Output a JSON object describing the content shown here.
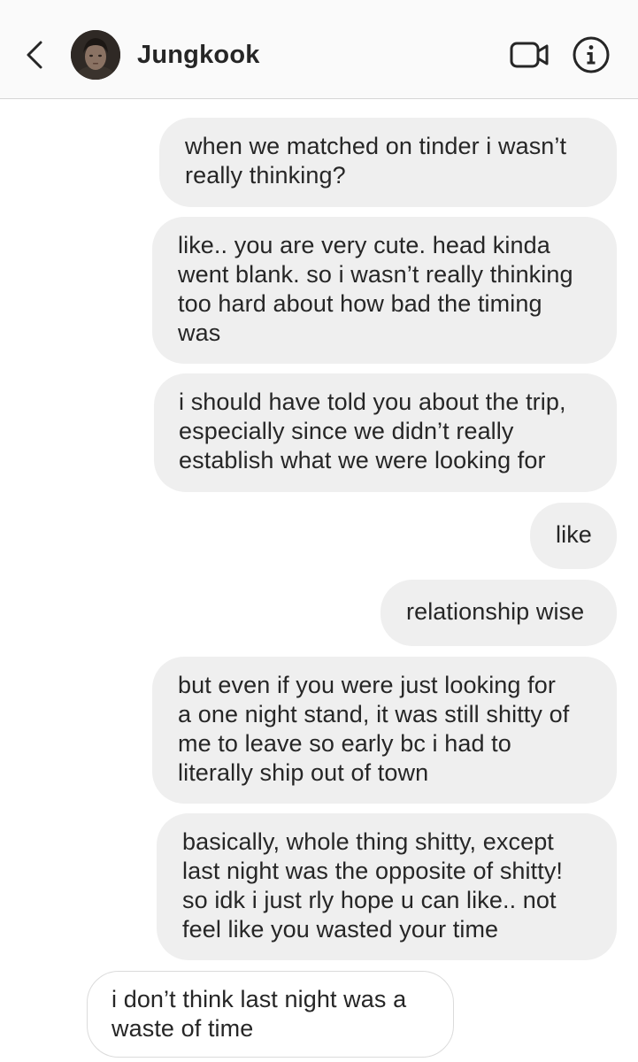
{
  "header": {
    "contact_name": "Jungkook",
    "back_icon": "chevron-left-icon",
    "video_icon": "video-camera-icon",
    "info_icon": "info-circle-icon"
  },
  "messages": [
    {
      "sender": "me",
      "text": "when we matched on tinder i wasn’t\nreally thinking?"
    },
    {
      "sender": "me",
      "text": "like.. you are very cute. head kinda\nwent blank. so i wasn’t really thinking\ntoo hard about how bad the timing\nwas"
    },
    {
      "sender": "me",
      "text": "i should have told you about the trip,\nespecially since we didn’t really\nestablish what we were looking for"
    },
    {
      "sender": "me",
      "text": "like"
    },
    {
      "sender": "me",
      "text": "relationship wise"
    },
    {
      "sender": "me",
      "text": "but even if you were just looking for\na one night stand, it was still shitty of\nme to leave so early bc i had to\nliterally ship out of town"
    },
    {
      "sender": "me",
      "text": "basically, whole thing shitty, except\nlast night was the opposite of shitty!\nso idk i just rly hope u can like.. not\nfeel like you wasted your time"
    },
    {
      "sender": "them",
      "text": "i don’t think last night was a\nwaste of time"
    }
  ],
  "colors": {
    "outgoing_bubble": "#efefef",
    "incoming_border": "#dbdbdb",
    "text": "#262626",
    "header_bg": "#fafafa"
  }
}
